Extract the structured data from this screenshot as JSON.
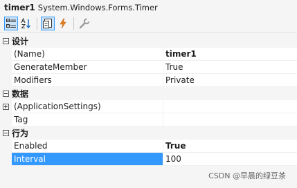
{
  "header": {
    "name": "timer1",
    "type": "System.Windows.Forms.Timer"
  },
  "toolbar": {
    "buttons": [
      {
        "icon": "categorized-icon",
        "active": true
      },
      {
        "icon": "alphabetical-icon",
        "active": false
      },
      {
        "icon": "properties-icon",
        "active": true
      },
      {
        "icon": "events-lightning-icon",
        "active": false
      },
      {
        "icon": "property-pages-wrench-icon",
        "active": false
      }
    ]
  },
  "categories": {
    "design": {
      "label": "设计",
      "expanded": true
    },
    "data": {
      "label": "数据",
      "expanded": true
    },
    "behavior": {
      "label": "行为",
      "expanded": true
    }
  },
  "properties": {
    "name": {
      "label": "(Name)",
      "value": "timer1"
    },
    "generate_member": {
      "label": "GenerateMember",
      "value": "True"
    },
    "modifiers": {
      "label": "Modifiers",
      "value": "Private"
    },
    "application_settings": {
      "label": "(ApplicationSettings)",
      "value": ""
    },
    "tag": {
      "label": "Tag",
      "value": ""
    },
    "enabled": {
      "label": "Enabled",
      "value": "True"
    },
    "interval": {
      "label": "Interval",
      "value": "100"
    }
  },
  "watermark": "CSDN @早晨的绿豆茶"
}
